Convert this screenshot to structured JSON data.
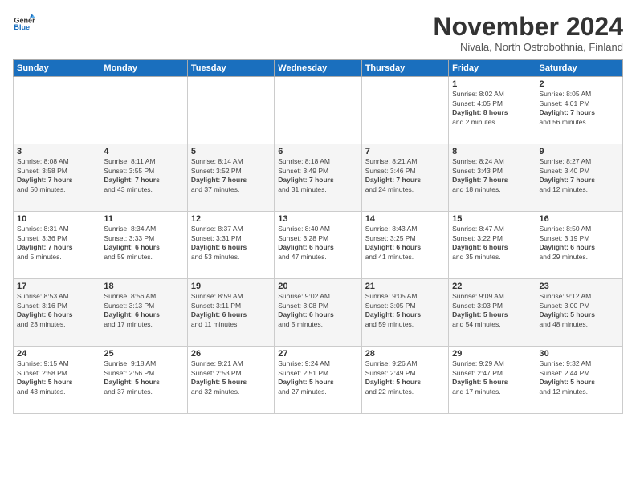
{
  "logo": {
    "line1": "General",
    "line2": "Blue"
  },
  "title": "November 2024",
  "subtitle": "Nivala, North Ostrobothnia, Finland",
  "days_header": [
    "Sunday",
    "Monday",
    "Tuesday",
    "Wednesday",
    "Thursday",
    "Friday",
    "Saturday"
  ],
  "weeks": [
    [
      {
        "day": "",
        "info": ""
      },
      {
        "day": "",
        "info": ""
      },
      {
        "day": "",
        "info": ""
      },
      {
        "day": "",
        "info": ""
      },
      {
        "day": "",
        "info": ""
      },
      {
        "day": "1",
        "info": "Sunrise: 8:02 AM\nSunset: 4:05 PM\nDaylight: 8 hours\nand 2 minutes."
      },
      {
        "day": "2",
        "info": "Sunrise: 8:05 AM\nSunset: 4:01 PM\nDaylight: 7 hours\nand 56 minutes."
      }
    ],
    [
      {
        "day": "3",
        "info": "Sunrise: 8:08 AM\nSunset: 3:58 PM\nDaylight: 7 hours\nand 50 minutes."
      },
      {
        "day": "4",
        "info": "Sunrise: 8:11 AM\nSunset: 3:55 PM\nDaylight: 7 hours\nand 43 minutes."
      },
      {
        "day": "5",
        "info": "Sunrise: 8:14 AM\nSunset: 3:52 PM\nDaylight: 7 hours\nand 37 minutes."
      },
      {
        "day": "6",
        "info": "Sunrise: 8:18 AM\nSunset: 3:49 PM\nDaylight: 7 hours\nand 31 minutes."
      },
      {
        "day": "7",
        "info": "Sunrise: 8:21 AM\nSunset: 3:46 PM\nDaylight: 7 hours\nand 24 minutes."
      },
      {
        "day": "8",
        "info": "Sunrise: 8:24 AM\nSunset: 3:43 PM\nDaylight: 7 hours\nand 18 minutes."
      },
      {
        "day": "9",
        "info": "Sunrise: 8:27 AM\nSunset: 3:40 PM\nDaylight: 7 hours\nand 12 minutes."
      }
    ],
    [
      {
        "day": "10",
        "info": "Sunrise: 8:31 AM\nSunset: 3:36 PM\nDaylight: 7 hours\nand 5 minutes."
      },
      {
        "day": "11",
        "info": "Sunrise: 8:34 AM\nSunset: 3:33 PM\nDaylight: 6 hours\nand 59 minutes."
      },
      {
        "day": "12",
        "info": "Sunrise: 8:37 AM\nSunset: 3:31 PM\nDaylight: 6 hours\nand 53 minutes."
      },
      {
        "day": "13",
        "info": "Sunrise: 8:40 AM\nSunset: 3:28 PM\nDaylight: 6 hours\nand 47 minutes."
      },
      {
        "day": "14",
        "info": "Sunrise: 8:43 AM\nSunset: 3:25 PM\nDaylight: 6 hours\nand 41 minutes."
      },
      {
        "day": "15",
        "info": "Sunrise: 8:47 AM\nSunset: 3:22 PM\nDaylight: 6 hours\nand 35 minutes."
      },
      {
        "day": "16",
        "info": "Sunrise: 8:50 AM\nSunset: 3:19 PM\nDaylight: 6 hours\nand 29 minutes."
      }
    ],
    [
      {
        "day": "17",
        "info": "Sunrise: 8:53 AM\nSunset: 3:16 PM\nDaylight: 6 hours\nand 23 minutes."
      },
      {
        "day": "18",
        "info": "Sunrise: 8:56 AM\nSunset: 3:13 PM\nDaylight: 6 hours\nand 17 minutes."
      },
      {
        "day": "19",
        "info": "Sunrise: 8:59 AM\nSunset: 3:11 PM\nDaylight: 6 hours\nand 11 minutes."
      },
      {
        "day": "20",
        "info": "Sunrise: 9:02 AM\nSunset: 3:08 PM\nDaylight: 6 hours\nand 5 minutes."
      },
      {
        "day": "21",
        "info": "Sunrise: 9:05 AM\nSunset: 3:05 PM\nDaylight: 5 hours\nand 59 minutes."
      },
      {
        "day": "22",
        "info": "Sunrise: 9:09 AM\nSunset: 3:03 PM\nDaylight: 5 hours\nand 54 minutes."
      },
      {
        "day": "23",
        "info": "Sunrise: 9:12 AM\nSunset: 3:00 PM\nDaylight: 5 hours\nand 48 minutes."
      }
    ],
    [
      {
        "day": "24",
        "info": "Sunrise: 9:15 AM\nSunset: 2:58 PM\nDaylight: 5 hours\nand 43 minutes."
      },
      {
        "day": "25",
        "info": "Sunrise: 9:18 AM\nSunset: 2:56 PM\nDaylight: 5 hours\nand 37 minutes."
      },
      {
        "day": "26",
        "info": "Sunrise: 9:21 AM\nSunset: 2:53 PM\nDaylight: 5 hours\nand 32 minutes."
      },
      {
        "day": "27",
        "info": "Sunrise: 9:24 AM\nSunset: 2:51 PM\nDaylight: 5 hours\nand 27 minutes."
      },
      {
        "day": "28",
        "info": "Sunrise: 9:26 AM\nSunset: 2:49 PM\nDaylight: 5 hours\nand 22 minutes."
      },
      {
        "day": "29",
        "info": "Sunrise: 9:29 AM\nSunset: 2:47 PM\nDaylight: 5 hours\nand 17 minutes."
      },
      {
        "day": "30",
        "info": "Sunrise: 9:32 AM\nSunset: 2:44 PM\nDaylight: 5 hours\nand 12 minutes."
      }
    ]
  ]
}
